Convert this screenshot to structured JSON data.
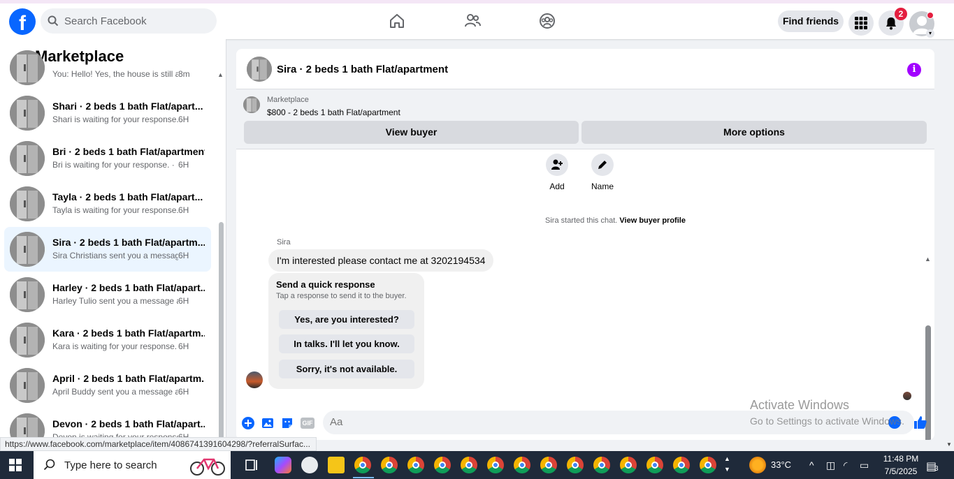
{
  "topbar": {
    "logo": "f",
    "search_placeholder": "Search Facebook",
    "find_friends": "Find friends",
    "notification_count": "2"
  },
  "sidebar": {
    "title": "Marketplace",
    "conversations": [
      {
        "title": "",
        "preview": "You: Hello! Yes, the house is still av...",
        "time": "8m"
      },
      {
        "title": "Shari · 2 beds 1 bath Flat/apart...",
        "preview": "Shari is waiting for your response. ·",
        "time": "6H"
      },
      {
        "title": "Bri · 2 beds 1 bath Flat/apartment",
        "preview": "Bri is waiting for your response. ·",
        "time": "6H"
      },
      {
        "title": "Tayla · 2 beds 1 bath Flat/apart...",
        "preview": "Tayla is waiting for your response. ·",
        "time": "6H"
      },
      {
        "title": "Sira · 2 beds 1 bath Flat/apartm...",
        "preview": "Sira Christians sent you a message ...",
        "time": "6H"
      },
      {
        "title": "Harley · 2 beds 1 bath Flat/apart...",
        "preview": "Harley Tulio sent you a message a...",
        "time": "6H"
      },
      {
        "title": "Kara · 2 beds 1 bath Flat/apartm...",
        "preview": "Kara is waiting for your response. ·",
        "time": "6H"
      },
      {
        "title": "April · 2 beds 1 bath Flat/apartm...",
        "preview": "April Buddy sent you a message a...",
        "time": "6H"
      },
      {
        "title": "Devon · 2 beds 1 bath Flat/apart...",
        "preview": "Devon is waiting for your response ·",
        "time": "6H"
      }
    ]
  },
  "chat": {
    "title": "Sira · 2 beds 1 bath Flat/apartment",
    "listing_category": "Marketplace",
    "listing_price": "$800 - 2 beds 1 bath Flat/apartment",
    "view_buyer": "View buyer",
    "more_options": "More options",
    "action_add": "Add",
    "action_name": "Name",
    "system_note": "Sira started this chat.",
    "system_link": "View buyer profile",
    "sender": "Sira",
    "message": "I'm interested please contact me at 3202194534",
    "quick_title": "Send a quick response",
    "quick_sub": "Tap a response to send it to the buyer.",
    "quick_replies": [
      "Yes, are you interested?",
      "In talks. I'll let you know.",
      "Sorry, it's not available."
    ],
    "composer_placeholder": "Aa",
    "gif_label": "GIF"
  },
  "watermark": {
    "line1": "Activate Windows",
    "line2": "Go to Settings to activate Windows."
  },
  "status_url": "https://www.facebook.com/marketplace/item/4086741391604298/?referralSurfac...",
  "taskbar": {
    "search": "Type here to search",
    "temperature": "33°C",
    "time": "11:48 PM",
    "date": "7/5/2025",
    "notif_count": "3"
  },
  "colors": {
    "fb_blue": "#0866ff",
    "active_row": "#ebf5ff",
    "info_purple": "#a200ff",
    "badge_red": "#e41e3f"
  }
}
